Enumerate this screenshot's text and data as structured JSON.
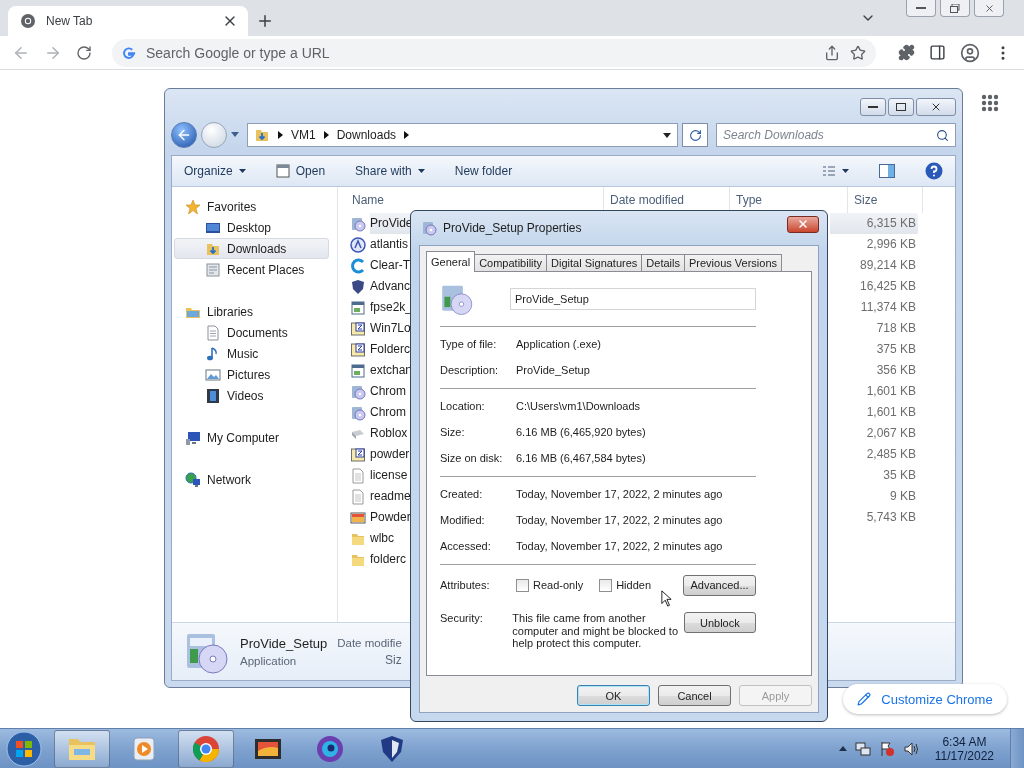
{
  "browser": {
    "tab": {
      "title": "New Tab",
      "selected": true
    },
    "address": {
      "placeholder": "Search Google or type a URL"
    },
    "customize_button": "Customize Chrome"
  },
  "explorer": {
    "breadcrumb": [
      "VM1",
      "Downloads"
    ],
    "search": {
      "placeholder": "Search Downloads"
    },
    "toolbar": [
      {
        "label": "Organize",
        "kind": "menu"
      },
      {
        "label": "Open",
        "kind": "open"
      },
      {
        "label": "Share with",
        "kind": "menu"
      },
      {
        "label": "New folder",
        "kind": "plain"
      }
    ],
    "nav": [
      {
        "label": "Favorites",
        "kind": "star",
        "selected": false,
        "children": [
          {
            "label": "Desktop",
            "kind": "desktop",
            "selected": false
          },
          {
            "label": "Downloads",
            "kind": "downloads",
            "selected": true
          },
          {
            "label": "Recent Places",
            "kind": "recent",
            "selected": false
          }
        ]
      },
      {
        "label": "Libraries",
        "kind": "library",
        "selected": false,
        "children": [
          {
            "label": "Documents",
            "kind": "document",
            "selected": false
          },
          {
            "label": "Music",
            "kind": "music",
            "selected": false
          },
          {
            "label": "Pictures",
            "kind": "pictures",
            "selected": false
          },
          {
            "label": "Videos",
            "kind": "videos",
            "selected": false
          }
        ]
      },
      {
        "label": "My Computer",
        "kind": "computer",
        "selected": false
      },
      {
        "label": "Network",
        "kind": "network",
        "selected": false
      }
    ],
    "columns": [
      "Name",
      "Date modified",
      "Type",
      "Size"
    ],
    "files": [
      {
        "name": "ProVide",
        "size": "6,315 KB",
        "kind": "installer",
        "selected": true
      },
      {
        "name": "atlantis",
        "size": "2,996 KB",
        "kind": "circle",
        "selected": false
      },
      {
        "name": "Clear-T",
        "size": "89,214 KB",
        "kind": "ring",
        "selected": false
      },
      {
        "name": "Advanc",
        "size": "16,425 KB",
        "kind": "shield",
        "selected": false
      },
      {
        "name": "fpse2k_",
        "size": "11,374 KB",
        "kind": "program",
        "selected": false
      },
      {
        "name": "Win7Lo",
        "size": "718 KB",
        "kind": "archive",
        "selected": false
      },
      {
        "name": "Folderc",
        "size": "375 KB",
        "kind": "archive",
        "selected": false
      },
      {
        "name": "extchan",
        "size": "356 KB",
        "kind": "program",
        "selected": false
      },
      {
        "name": "Chrom",
        "size": "1,601 KB",
        "kind": "installer",
        "selected": false
      },
      {
        "name": "Chrom",
        "size": "1,601 KB",
        "kind": "installer",
        "selected": false
      },
      {
        "name": "Roblox",
        "size": "2,067 KB",
        "kind": "blank",
        "selected": false
      },
      {
        "name": "powder",
        "size": "2,485 KB",
        "kind": "archive",
        "selected": false
      },
      {
        "name": "license",
        "size": "35 KB",
        "kind": "text",
        "selected": false
      },
      {
        "name": "readme",
        "size": "9 KB",
        "kind": "text",
        "selected": false
      },
      {
        "name": "Powder",
        "size": "5,743 KB",
        "kind": "image",
        "selected": false
      },
      {
        "name": "wlbc",
        "kind": "folder",
        "selected": false
      },
      {
        "name": "folderc",
        "kind": "folder",
        "selected": false
      }
    ],
    "details": {
      "name": "ProVide_Setup",
      "type": "Application",
      "date_label": "Date modifie",
      "size_label": "Siz"
    }
  },
  "dialog": {
    "title": "ProVide_Setup Properties",
    "tabs": [
      {
        "label": "General",
        "selected": true
      },
      {
        "label": "Compatibility",
        "selected": false
      },
      {
        "label": "Digital Signatures",
        "selected": false
      },
      {
        "label": "Details",
        "selected": false
      },
      {
        "label": "Previous Versions",
        "selected": false
      }
    ],
    "name_field": {
      "value": "ProVide_Setup"
    },
    "groups": [
      [
        {
          "label": "Type of file:",
          "value": "Application (.exe)"
        },
        {
          "label": "Description:",
          "value": "ProVide_Setup"
        }
      ],
      [
        {
          "label": "Location:",
          "value": "C:\\Users\\vm1\\Downloads"
        },
        {
          "label": "Size:",
          "value": "6.16 MB (6,465,920 bytes)"
        },
        {
          "label": "Size on disk:",
          "value": "6.16 MB (6,467,584 bytes)"
        }
      ],
      [
        {
          "label": "Created:",
          "value": "Today, November 17, 2022, 2 minutes ago"
        },
        {
          "label": "Modified:",
          "value": "Today, November 17, 2022, 2 minutes ago"
        },
        {
          "label": "Accessed:",
          "value": "Today, November 17, 2022, 2 minutes ago"
        }
      ]
    ],
    "attributes": {
      "label": "Attributes:",
      "options": [
        {
          "label": "Read-only",
          "checked": false
        },
        {
          "label": "Hidden",
          "checked": false
        }
      ],
      "button": "Advanced..."
    },
    "security": {
      "label": "Security:",
      "text": "This file came from another computer and might be blocked to help protect this computer.",
      "button": "Unblock"
    },
    "buttons": [
      {
        "label": "OK",
        "kind": "default",
        "disabled": false
      },
      {
        "label": "Cancel",
        "kind": "normal",
        "disabled": false
      },
      {
        "label": "Apply",
        "kind": "normal",
        "disabled": true
      }
    ]
  },
  "taskbar": {
    "apps": [
      {
        "kind": "explorer",
        "active": true
      },
      {
        "kind": "player",
        "active": false
      },
      {
        "kind": "chrome",
        "active": true
      },
      {
        "kind": "video",
        "active": false
      },
      {
        "kind": "swirl",
        "active": false
      },
      {
        "kind": "shield",
        "active": false
      }
    ],
    "time": "6:34 AM",
    "date": "11/17/2022"
  }
}
